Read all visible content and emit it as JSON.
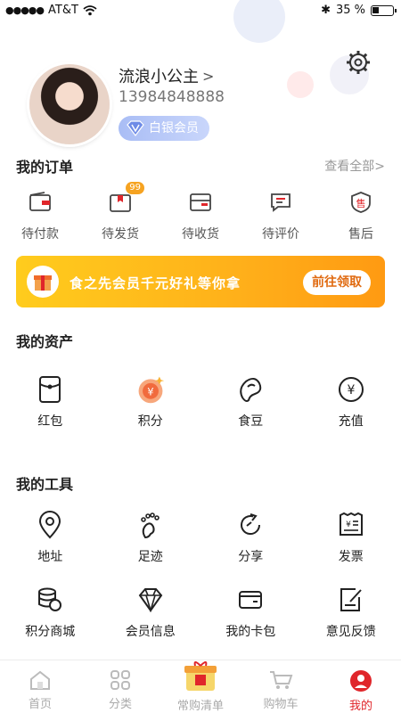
{
  "status_bar": {
    "carrier": "AT&T",
    "battery": "35 %"
  },
  "profile": {
    "name": "流浪小公主",
    "phone": "13984848888",
    "member_level": "白银会员"
  },
  "orders": {
    "title": "我的订单",
    "view_all": "查看全部",
    "items": [
      {
        "label": "待付款",
        "icon": "wallet-icon"
      },
      {
        "label": "待发货",
        "icon": "package-icon",
        "badge": "99"
      },
      {
        "label": "待收货",
        "icon": "box-icon"
      },
      {
        "label": "待评价",
        "icon": "comment-icon"
      },
      {
        "label": "售后",
        "icon": "after-sale-icon",
        "icon_text": "售"
      }
    ]
  },
  "banner": {
    "text": "食之先会员千元好礼等你拿",
    "button": "前往领取"
  },
  "assets": {
    "title": "我的资产",
    "items": [
      {
        "label": "红包",
        "icon": "red-envelope-icon"
      },
      {
        "label": "积分",
        "icon": "points-coin-icon",
        "icon_text": "¥"
      },
      {
        "label": "食豆",
        "icon": "bean-icon"
      },
      {
        "label": "充值",
        "icon": "recharge-icon",
        "icon_text": "¥"
      }
    ]
  },
  "tools": {
    "title": "我的工具",
    "items": [
      {
        "label": "地址",
        "icon": "location-icon"
      },
      {
        "label": "足迹",
        "icon": "footprint-icon"
      },
      {
        "label": "分享",
        "icon": "share-icon"
      },
      {
        "label": "发票",
        "icon": "invoice-icon",
        "icon_text": "¥"
      },
      {
        "label": "积分商城",
        "icon": "coin-stack-icon"
      },
      {
        "label": "会员信息",
        "icon": "diamond-icon"
      },
      {
        "label": "我的卡包",
        "icon": "card-wallet-icon"
      },
      {
        "label": "意见反馈",
        "icon": "feedback-icon"
      }
    ]
  },
  "tab_bar": {
    "items": [
      {
        "label": "首页",
        "icon": "home-icon"
      },
      {
        "label": "分类",
        "icon": "category-icon"
      },
      {
        "label": "常购清单",
        "icon": "shopping-list-icon"
      },
      {
        "label": "购物车",
        "icon": "cart-icon"
      },
      {
        "label": "我的",
        "icon": "profile-icon"
      }
    ],
    "active": "我的"
  },
  "colors": {
    "accent": "#e0262b",
    "banner": "#ffb01a",
    "member_badge": "#a9bdf5",
    "badge_orange": "#f6a321"
  }
}
